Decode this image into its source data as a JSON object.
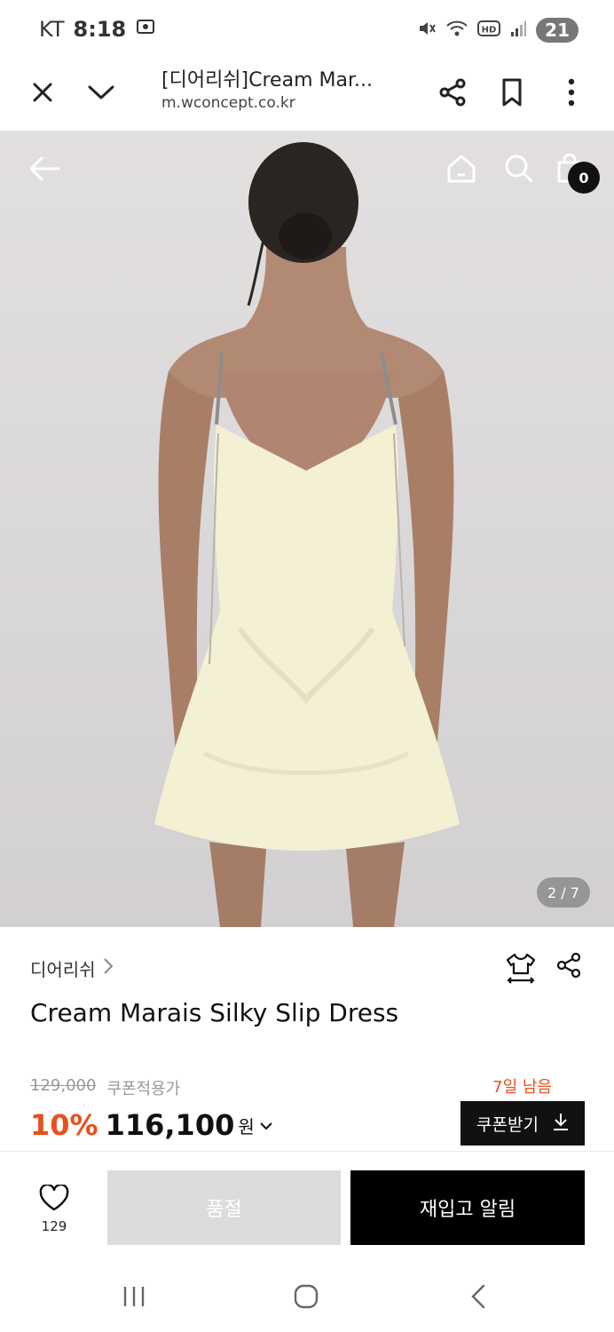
{
  "status_bar": {
    "carrier": "KT",
    "time": "8:18",
    "notification_count": "21"
  },
  "browser": {
    "page_title": "[디어리쉬]Cream Mar...",
    "url": "m.wconcept.co.kr"
  },
  "gallery": {
    "page_indicator": "2 / 7",
    "cart_count": "0"
  },
  "product": {
    "brand": "디어리쉬",
    "name": "Cream Marais Silky Slip Dress",
    "original_price": "129,000",
    "coupon_note": "쿠폰적용가",
    "discount": "10%",
    "sale_price": "116,100",
    "currency": "원",
    "coupon_days_left": "7일 남음",
    "coupon_button": "쿠폰받기"
  },
  "actions": {
    "like_count": "129",
    "soldout_label": "품절",
    "restock_label": "재입고 알림"
  },
  "colors": {
    "accent": "#e8501c",
    "primary": "#111111",
    "soldout": "#dcdcdc"
  }
}
